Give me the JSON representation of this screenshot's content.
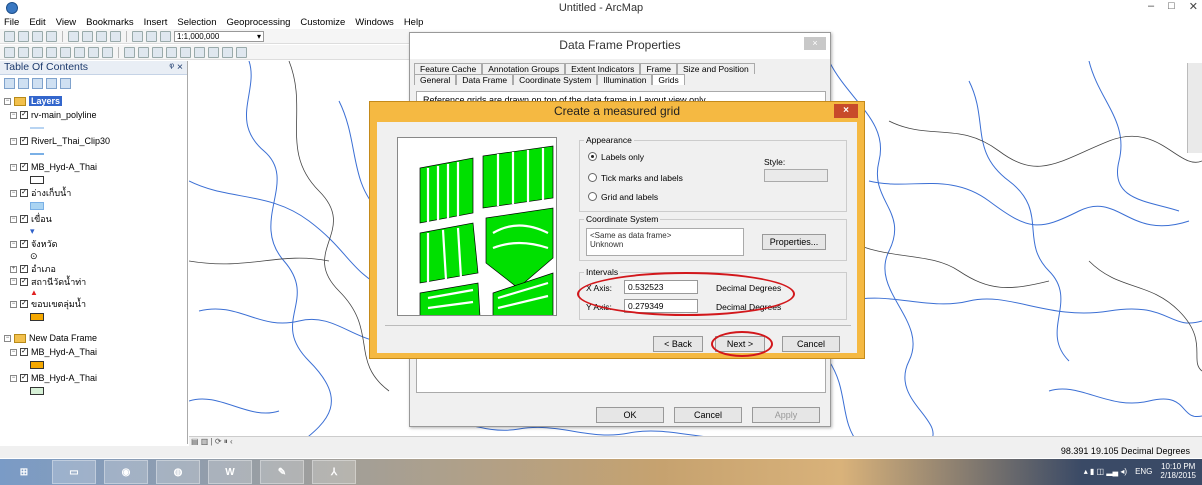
{
  "window": {
    "title": "Untitled - ArcMap",
    "controls": [
      "–",
      "□",
      "✕"
    ]
  },
  "menu": [
    "File",
    "Edit",
    "View",
    "Bookmarks",
    "Insert",
    "Selection",
    "Geoprocessing",
    "Customize",
    "Windows",
    "Help"
  ],
  "toolbar": {
    "scale": "1:1,000,000"
  },
  "toc": {
    "title": "Table Of Contents",
    "pin": "ᵠ ×",
    "layers_label": "Layers",
    "items": [
      "rv-main_polyline",
      "RiverL_Thai_Clip30",
      "MB_Hyd-A_Thai",
      "อ่างเก็บน้ำ",
      "เขื่อน",
      "จังหวัด",
      "อำเภอ",
      "สถานีวัดน้ำท่า",
      "ขอบเขตลุ่มน้ำ"
    ],
    "frame2_label": "New Data Frame",
    "frame2_items": [
      "MB_Hyd-A_Thai",
      "MB_Hyd-A_Thai"
    ]
  },
  "dfp": {
    "title": "Data Frame Properties",
    "close": "×",
    "tabs_row1": [
      "Feature Cache",
      "Annotation Groups",
      "Extent Indicators",
      "Frame",
      "Size and Position"
    ],
    "tabs_row2": [
      "General",
      "Data Frame",
      "Coordinate System",
      "Illumination",
      "Grids"
    ],
    "body_text": "Reference grids are drawn on top of the data frame in Layout view only.",
    "ok": "OK",
    "cancel": "Cancel",
    "apply": "Apply"
  },
  "cmg": {
    "title": "Create a measured grid",
    "close": "×",
    "appearance_label": "Appearance",
    "radio_labels_only": "Labels only",
    "radio_tick": "Tick marks and labels",
    "radio_grid": "Grid and labels",
    "style_label": "Style:",
    "coord_label": "Coordinate System",
    "coord_text_1": "<Same as data frame>",
    "coord_text_2": "Unknown",
    "properties_btn": "Properties...",
    "intervals_label": "Intervals",
    "x_axis_label": "X Axis:",
    "x_axis_value": "0.532523",
    "x_units": "Decimal Degrees",
    "y_axis_label": "Y Axis:",
    "y_axis_value": "0.279349",
    "y_units": "Decimal Degrees",
    "back": "< Back",
    "next": "Next >",
    "cancel": "Cancel"
  },
  "status": {
    "coords": "98.391  19.105 Decimal Degrees"
  },
  "taskbar": {
    "time": "10:10 PM",
    "date": "2/18/2015",
    "lang": "ENG"
  },
  "colors": {
    "accent_orange": "#f5b942",
    "highlight_red": "#d2171b",
    "preview_green": "#00e000"
  }
}
